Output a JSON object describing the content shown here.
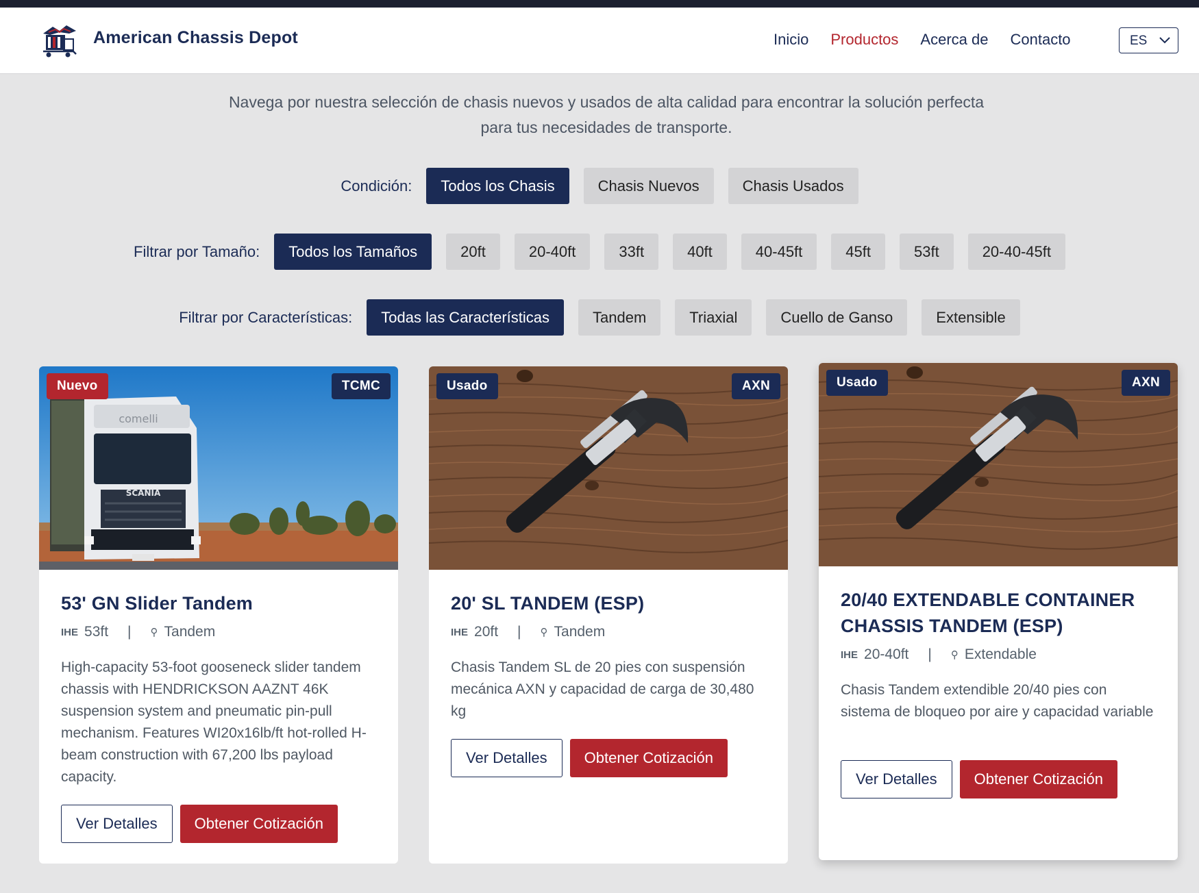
{
  "header": {
    "brand": "American Chassis Depot",
    "nav": [
      "Inicio",
      "Productos",
      "Acerca de",
      "Contacto"
    ],
    "active_nav": "Productos",
    "language": "ES"
  },
  "intro": "Navega por nuestra selección de chasis nuevos y usados de alta calidad para encontrar la solución perfecta para tus necesidades de transporte.",
  "filters": {
    "condition": {
      "label": "Condición:",
      "options": [
        "Todos los Chasis",
        "Chasis Nuevos",
        "Chasis Usados"
      ],
      "selected": "Todos los Chasis"
    },
    "size": {
      "label": "Filtrar por Tamaño:",
      "options": [
        "Todos los Tamaños",
        "20ft",
        "20-40ft",
        "33ft",
        "40ft",
        "40-45ft",
        "45ft",
        "53ft",
        "20-40-45ft"
      ],
      "selected": "Todos los Tamaños"
    },
    "features": {
      "label": "Filtrar por Características:",
      "options": [
        "Todas las Características",
        "Tandem",
        "Triaxial",
        "Cuello de Ganso",
        "Extensible"
      ],
      "selected": "Todas las Características"
    }
  },
  "products": [
    {
      "condition": "Nuevo",
      "brand": "TCMC",
      "image": "truck-photo",
      "title": "53' GN Slider Tandem",
      "size": "53ft",
      "axle": "Tandem",
      "description": "High-capacity 53-foot gooseneck slider tandem chassis with HENDRICKSON AAZNT 46K suspension system and pneumatic pin-pull mechanism. Features WI20x16lb/ft hot-rolled H-beam construction with 67,200 lbs payload capacity.",
      "details_label": "Ver Detalles",
      "quote_label": "Obtener Cotización"
    },
    {
      "condition": "Usado",
      "brand": "AXN",
      "image": "hammer-photo",
      "title": "20' SL TANDEM (ESP)",
      "size": "20ft",
      "axle": "Tandem",
      "description": "Chasis Tandem SL de 20 pies con suspensión mecánica AXN y capacidad de carga de 30,480 kg",
      "details_label": "Ver Detalles",
      "quote_label": "Obtener Cotización"
    },
    {
      "condition": "Usado",
      "brand": "AXN",
      "image": "hammer-photo",
      "title": "20/40 EXTENDABLE CONTAINER CHASSIS TANDEM (ESP)",
      "size": "20-40ft",
      "axle": "Extendable",
      "description": "Chasis Tandem extendible 20/40 pies con sistema de bloqueo por aire y capacidad variable",
      "details_label": "Ver Detalles",
      "quote_label": "Obtener Cotización"
    }
  ],
  "colors": {
    "navy": "#1b2b55",
    "red": "#b3262e",
    "page_bg": "#e5e5e6"
  }
}
